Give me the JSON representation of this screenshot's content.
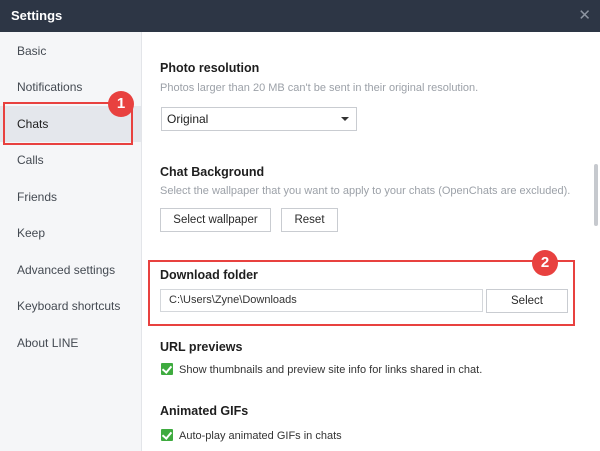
{
  "window": {
    "title": "Settings",
    "close_glyph": "✕"
  },
  "sidebar": {
    "items": [
      {
        "label": "Basic"
      },
      {
        "label": "Notifications"
      },
      {
        "label": "Chats"
      },
      {
        "label": "Calls"
      },
      {
        "label": "Friends"
      },
      {
        "label": "Keep"
      },
      {
        "label": "Advanced settings"
      },
      {
        "label": "Keyboard shortcuts"
      },
      {
        "label": "About LINE"
      }
    ],
    "active": "Chats"
  },
  "photo_resolution": {
    "heading": "Photo resolution",
    "description": "Photos larger than 20 MB can't be sent in their original resolution.",
    "selected": "Original"
  },
  "chat_background": {
    "heading": "Chat Background",
    "description": "Select the wallpaper that you want to apply to your chats (OpenChats are excluded).",
    "select_label": "Select wallpaper",
    "reset_label": "Reset"
  },
  "download_folder": {
    "heading": "Download folder",
    "path": "C:\\Users\\Zyne\\Downloads",
    "select_label": "Select"
  },
  "url_previews": {
    "heading": "URL previews",
    "checkbox_label": "Show thumbnails and preview site info for links shared in chat.",
    "checked": true
  },
  "animated_gifs": {
    "heading": "Animated GIFs",
    "checkbox_label": "Auto-play animated GIFs in chats",
    "checked": true
  },
  "annotations": {
    "badge_1": "1",
    "badge_2": "2",
    "color": "#e8413f"
  },
  "colors": {
    "titlebar": "#2d3645",
    "checkbox": "#3eab3f"
  }
}
